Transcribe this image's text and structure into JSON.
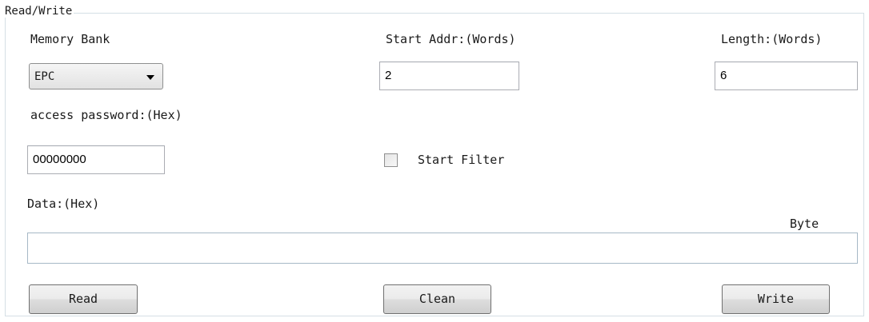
{
  "group": {
    "title": "Read/Write"
  },
  "memory_bank": {
    "label": "Memory Bank",
    "selected": "EPC"
  },
  "start_addr": {
    "label": "Start Addr:(Words)",
    "value": "2"
  },
  "length": {
    "label": "Length:(Words)",
    "value": "6"
  },
  "access_password": {
    "label": "access password:(Hex)",
    "value": "00000000"
  },
  "start_filter": {
    "label": "Start Filter",
    "checked": false
  },
  "data": {
    "label": "Data:(Hex)",
    "value": "",
    "unit_label": "Byte"
  },
  "buttons": {
    "read": "Read",
    "clean": "Clean",
    "write": "Write"
  }
}
